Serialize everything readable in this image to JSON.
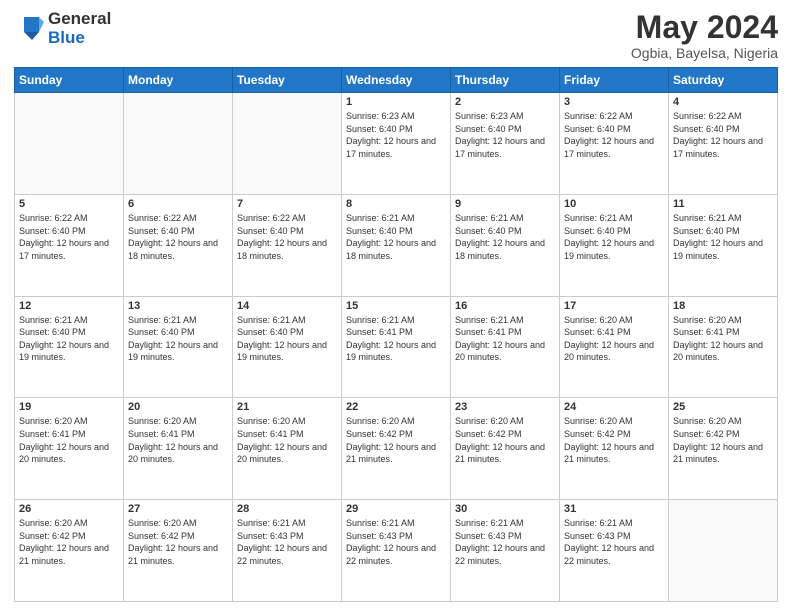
{
  "logo": {
    "general": "General",
    "blue": "Blue"
  },
  "header": {
    "title": "May 2024",
    "subtitle": "Ogbia, Bayelsa, Nigeria"
  },
  "weekdays": [
    "Sunday",
    "Monday",
    "Tuesday",
    "Wednesday",
    "Thursday",
    "Friday",
    "Saturday"
  ],
  "weeks": [
    [
      {
        "day": "",
        "info": ""
      },
      {
        "day": "",
        "info": ""
      },
      {
        "day": "",
        "info": ""
      },
      {
        "day": "1",
        "info": "Sunrise: 6:23 AM\nSunset: 6:40 PM\nDaylight: 12 hours and 17 minutes."
      },
      {
        "day": "2",
        "info": "Sunrise: 6:23 AM\nSunset: 6:40 PM\nDaylight: 12 hours and 17 minutes."
      },
      {
        "day": "3",
        "info": "Sunrise: 6:22 AM\nSunset: 6:40 PM\nDaylight: 12 hours and 17 minutes."
      },
      {
        "day": "4",
        "info": "Sunrise: 6:22 AM\nSunset: 6:40 PM\nDaylight: 12 hours and 17 minutes."
      }
    ],
    [
      {
        "day": "5",
        "info": "Sunrise: 6:22 AM\nSunset: 6:40 PM\nDaylight: 12 hours and 17 minutes."
      },
      {
        "day": "6",
        "info": "Sunrise: 6:22 AM\nSunset: 6:40 PM\nDaylight: 12 hours and 18 minutes."
      },
      {
        "day": "7",
        "info": "Sunrise: 6:22 AM\nSunset: 6:40 PM\nDaylight: 12 hours and 18 minutes."
      },
      {
        "day": "8",
        "info": "Sunrise: 6:21 AM\nSunset: 6:40 PM\nDaylight: 12 hours and 18 minutes."
      },
      {
        "day": "9",
        "info": "Sunrise: 6:21 AM\nSunset: 6:40 PM\nDaylight: 12 hours and 18 minutes."
      },
      {
        "day": "10",
        "info": "Sunrise: 6:21 AM\nSunset: 6:40 PM\nDaylight: 12 hours and 19 minutes."
      },
      {
        "day": "11",
        "info": "Sunrise: 6:21 AM\nSunset: 6:40 PM\nDaylight: 12 hours and 19 minutes."
      }
    ],
    [
      {
        "day": "12",
        "info": "Sunrise: 6:21 AM\nSunset: 6:40 PM\nDaylight: 12 hours and 19 minutes."
      },
      {
        "day": "13",
        "info": "Sunrise: 6:21 AM\nSunset: 6:40 PM\nDaylight: 12 hours and 19 minutes."
      },
      {
        "day": "14",
        "info": "Sunrise: 6:21 AM\nSunset: 6:40 PM\nDaylight: 12 hours and 19 minutes."
      },
      {
        "day": "15",
        "info": "Sunrise: 6:21 AM\nSunset: 6:41 PM\nDaylight: 12 hours and 19 minutes."
      },
      {
        "day": "16",
        "info": "Sunrise: 6:21 AM\nSunset: 6:41 PM\nDaylight: 12 hours and 20 minutes."
      },
      {
        "day": "17",
        "info": "Sunrise: 6:20 AM\nSunset: 6:41 PM\nDaylight: 12 hours and 20 minutes."
      },
      {
        "day": "18",
        "info": "Sunrise: 6:20 AM\nSunset: 6:41 PM\nDaylight: 12 hours and 20 minutes."
      }
    ],
    [
      {
        "day": "19",
        "info": "Sunrise: 6:20 AM\nSunset: 6:41 PM\nDaylight: 12 hours and 20 minutes."
      },
      {
        "day": "20",
        "info": "Sunrise: 6:20 AM\nSunset: 6:41 PM\nDaylight: 12 hours and 20 minutes."
      },
      {
        "day": "21",
        "info": "Sunrise: 6:20 AM\nSunset: 6:41 PM\nDaylight: 12 hours and 20 minutes."
      },
      {
        "day": "22",
        "info": "Sunrise: 6:20 AM\nSunset: 6:42 PM\nDaylight: 12 hours and 21 minutes."
      },
      {
        "day": "23",
        "info": "Sunrise: 6:20 AM\nSunset: 6:42 PM\nDaylight: 12 hours and 21 minutes."
      },
      {
        "day": "24",
        "info": "Sunrise: 6:20 AM\nSunset: 6:42 PM\nDaylight: 12 hours and 21 minutes."
      },
      {
        "day": "25",
        "info": "Sunrise: 6:20 AM\nSunset: 6:42 PM\nDaylight: 12 hours and 21 minutes."
      }
    ],
    [
      {
        "day": "26",
        "info": "Sunrise: 6:20 AM\nSunset: 6:42 PM\nDaylight: 12 hours and 21 minutes."
      },
      {
        "day": "27",
        "info": "Sunrise: 6:20 AM\nSunset: 6:42 PM\nDaylight: 12 hours and 21 minutes."
      },
      {
        "day": "28",
        "info": "Sunrise: 6:21 AM\nSunset: 6:43 PM\nDaylight: 12 hours and 22 minutes."
      },
      {
        "day": "29",
        "info": "Sunrise: 6:21 AM\nSunset: 6:43 PM\nDaylight: 12 hours and 22 minutes."
      },
      {
        "day": "30",
        "info": "Sunrise: 6:21 AM\nSunset: 6:43 PM\nDaylight: 12 hours and 22 minutes."
      },
      {
        "day": "31",
        "info": "Sunrise: 6:21 AM\nSunset: 6:43 PM\nDaylight: 12 hours and 22 minutes."
      },
      {
        "day": "",
        "info": ""
      }
    ]
  ]
}
